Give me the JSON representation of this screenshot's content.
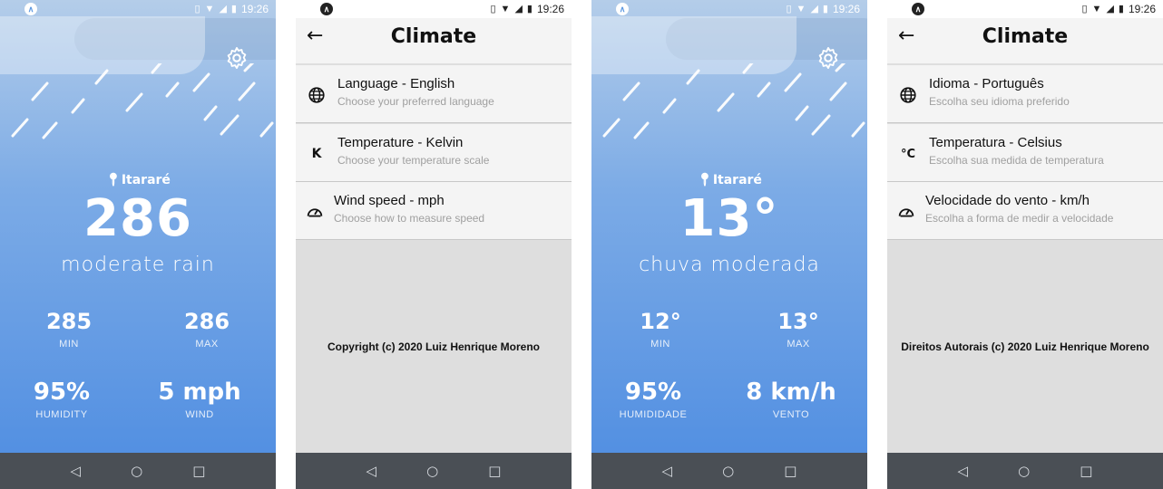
{
  "status": {
    "time": "19:26"
  },
  "navbar": {
    "back": "◁",
    "home": "○",
    "recents": "□"
  },
  "weather_en": {
    "city": "Itararé",
    "temperature": "286",
    "description": "moderate rain",
    "min_value": "285",
    "min_label": "MIN",
    "max_value": "286",
    "max_label": "MAX",
    "humidity_value": "95%",
    "humidity_label": "HUMIDITY",
    "wind_value": "5 mph",
    "wind_label": "WIND"
  },
  "settings_en": {
    "title": "Climate",
    "options": [
      {
        "icon": "globe-icon",
        "title": "Language - English",
        "subtitle": "Choose your preferred language"
      },
      {
        "icon": "kelvin-icon",
        "glyph": "K",
        "title": "Temperature - Kelvin",
        "subtitle": "Choose your temperature scale"
      },
      {
        "icon": "speedometer-icon",
        "title": "Wind speed - mph",
        "subtitle": "Choose how to measure speed"
      }
    ],
    "copyright": "Copyright (c) 2020 Luiz Henrique Moreno"
  },
  "weather_pt": {
    "city": "Itararé",
    "temperature": "13°",
    "description": "chuva moderada",
    "min_value": "12°",
    "min_label": "MIN",
    "max_value": "13°",
    "max_label": "MAX",
    "humidity_value": "95%",
    "humidity_label": "HUMIDIDADE",
    "wind_value": "8 km/h",
    "wind_label": "VENTO"
  },
  "settings_pt": {
    "title": "Climate",
    "options": [
      {
        "icon": "globe-icon",
        "title": "Idioma - Português",
        "subtitle": "Escolha seu idioma preferido"
      },
      {
        "icon": "celsius-icon",
        "glyph": "°C",
        "title": "Temperatura - Celsius",
        "subtitle": "Escolha sua medida de temperatura"
      },
      {
        "icon": "speedometer-icon",
        "title": "Velocidade do vento - km/h",
        "subtitle": "Escolha a forma de medir a velocidade"
      }
    ],
    "copyright": "Direitos Autorais (c) 2020 Luiz Henrique Moreno"
  },
  "colors": {
    "weather_top": "#b4cde9",
    "weather_bottom": "#5390e2",
    "settings_bg": "#dedede",
    "navbar_bg": "#4a4f55"
  }
}
